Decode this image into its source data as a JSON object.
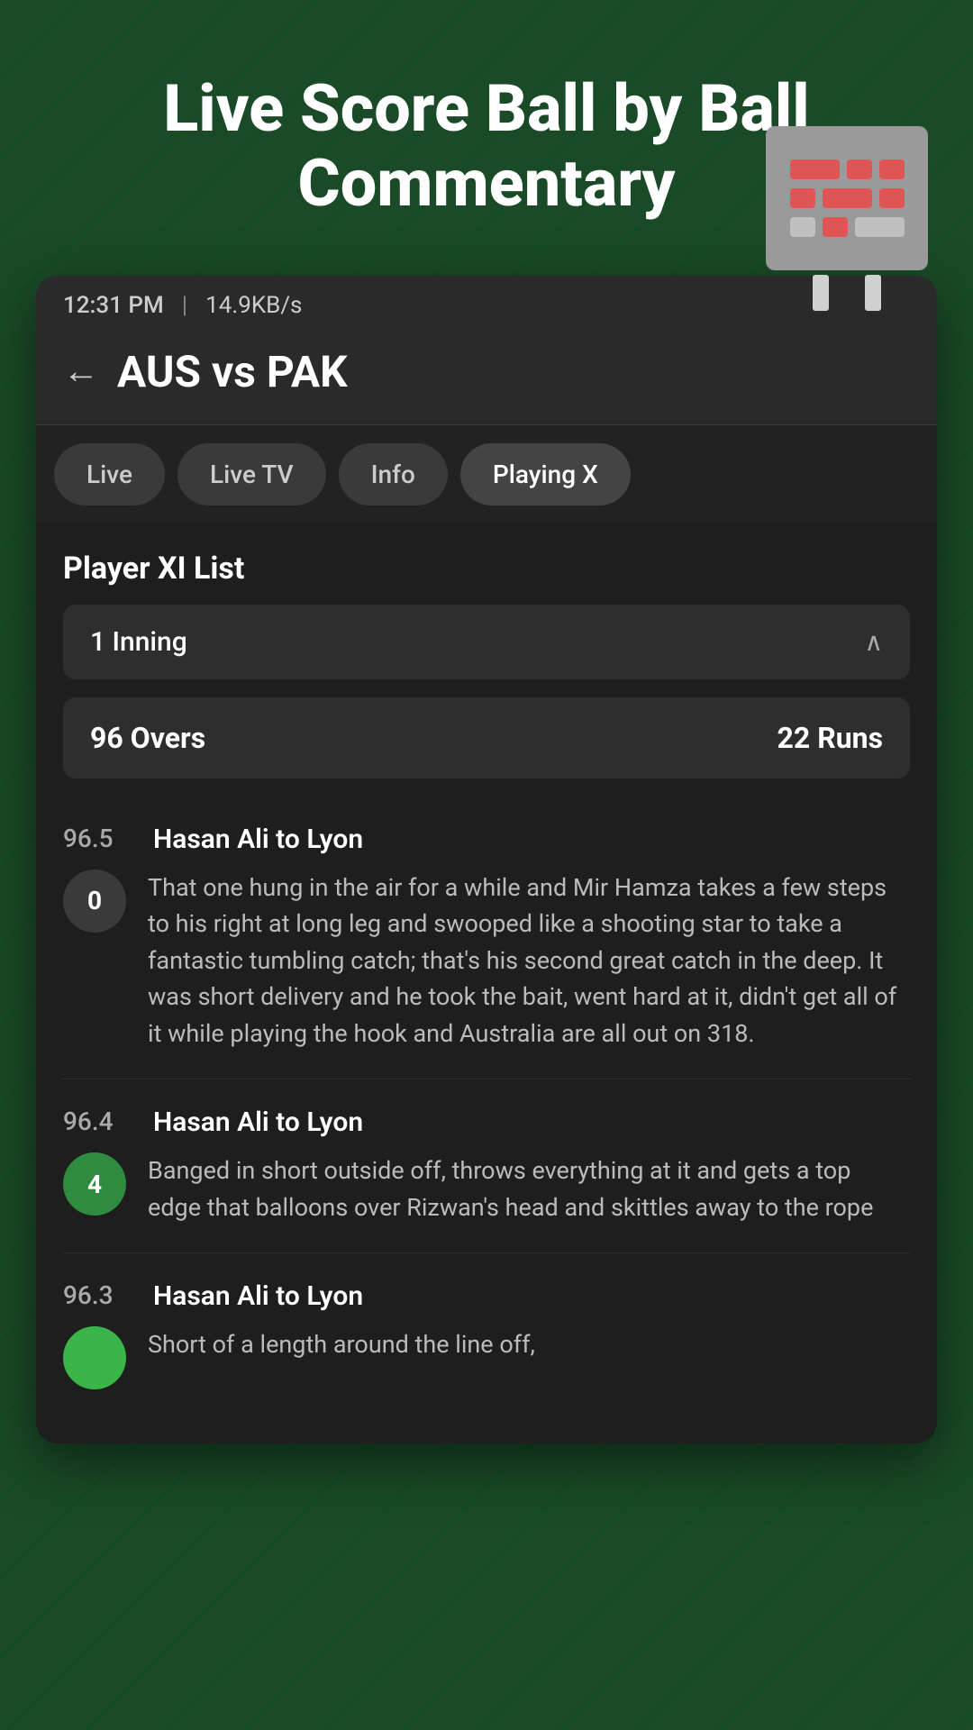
{
  "hero": {
    "title": "Live Score Ball by Ball Commentary"
  },
  "status_bar": {
    "time": "12:31 PM",
    "separator": "|",
    "network": "14.9KB/s"
  },
  "match_header": {
    "back_label": "←",
    "title": "AUS vs PAK"
  },
  "nav_tabs": [
    {
      "id": "live",
      "label": "Live",
      "active": false
    },
    {
      "id": "live-tv",
      "label": "Live TV",
      "active": false
    },
    {
      "id": "info",
      "label": "Info",
      "active": false
    },
    {
      "id": "playing-xi",
      "label": "Playing X",
      "active": true,
      "truncated": true
    }
  ],
  "content": {
    "section_title": "Player XI List",
    "inning_selector": {
      "label": "1 Inning",
      "chevron": "∧"
    },
    "overs_summary": {
      "overs_label": "96 Overs",
      "runs_label": "22 Runs"
    },
    "commentary": [
      {
        "over": "96.5",
        "bowler_batsman": "Hasan Ali to Lyon",
        "ball_value": "0",
        "ball_color": "default",
        "text": "That one hung in the air for a while and Mir Hamza takes a few steps to his right at long leg and swooped like a shooting star to take a fantastic tumbling catch; that's his second great catch in the deep. It was short delivery and he took the bait, went hard at it, didn't get all of it while playing the hook and Australia are all out on 318."
      },
      {
        "over": "96.4",
        "bowler_batsman": "Hasan Ali to Lyon",
        "ball_value": "4",
        "ball_color": "green",
        "text": "Banged in short outside off, throws everything at it and gets a top edge that balloons over Rizwan's head and skittles away to the rope"
      },
      {
        "over": "96.3",
        "bowler_batsman": "Hasan Ali to Lyon",
        "ball_value": "",
        "ball_color": "green-bright",
        "text": "Short of a length around the line off,"
      }
    ]
  }
}
